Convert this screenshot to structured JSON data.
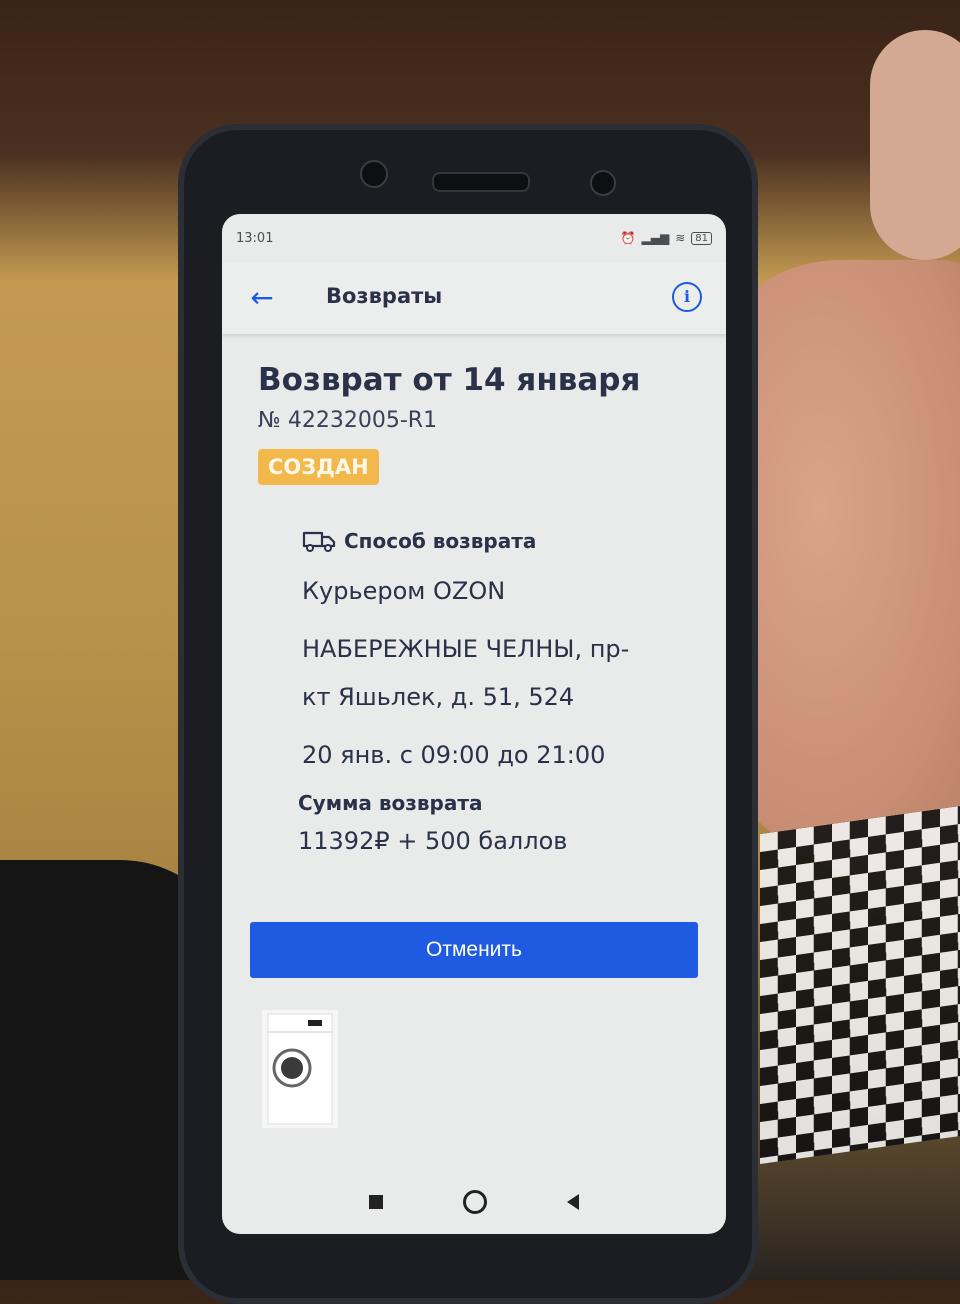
{
  "status_bar": {
    "time": "13:01",
    "battery": "81"
  },
  "header": {
    "title": "Возвраты"
  },
  "return": {
    "title": "Возврат от 14 января",
    "number": "№ 42232005-R1",
    "status": "СОЗДАН"
  },
  "method": {
    "title": "Способ возврата",
    "courier": "Курьером OZON",
    "address_line1": "НАБЕРЕЖНЫЕ ЧЕЛНЫ, пр-",
    "address_line2": "кт Яшьлек, д. 51, 524",
    "time_window": "20 янв. с 09:00 до 21:00"
  },
  "sum": {
    "title": "Сумма возврата",
    "value": "11392₽ + 500 баллов"
  },
  "actions": {
    "cancel_label": "Отменить"
  },
  "colors": {
    "accent": "#1f5be0",
    "badge": "#f2b84b",
    "text": "#2a3148"
  },
  "icons": [
    "back-arrow-icon",
    "info-icon",
    "truck-icon",
    "washing-machine-image"
  ]
}
